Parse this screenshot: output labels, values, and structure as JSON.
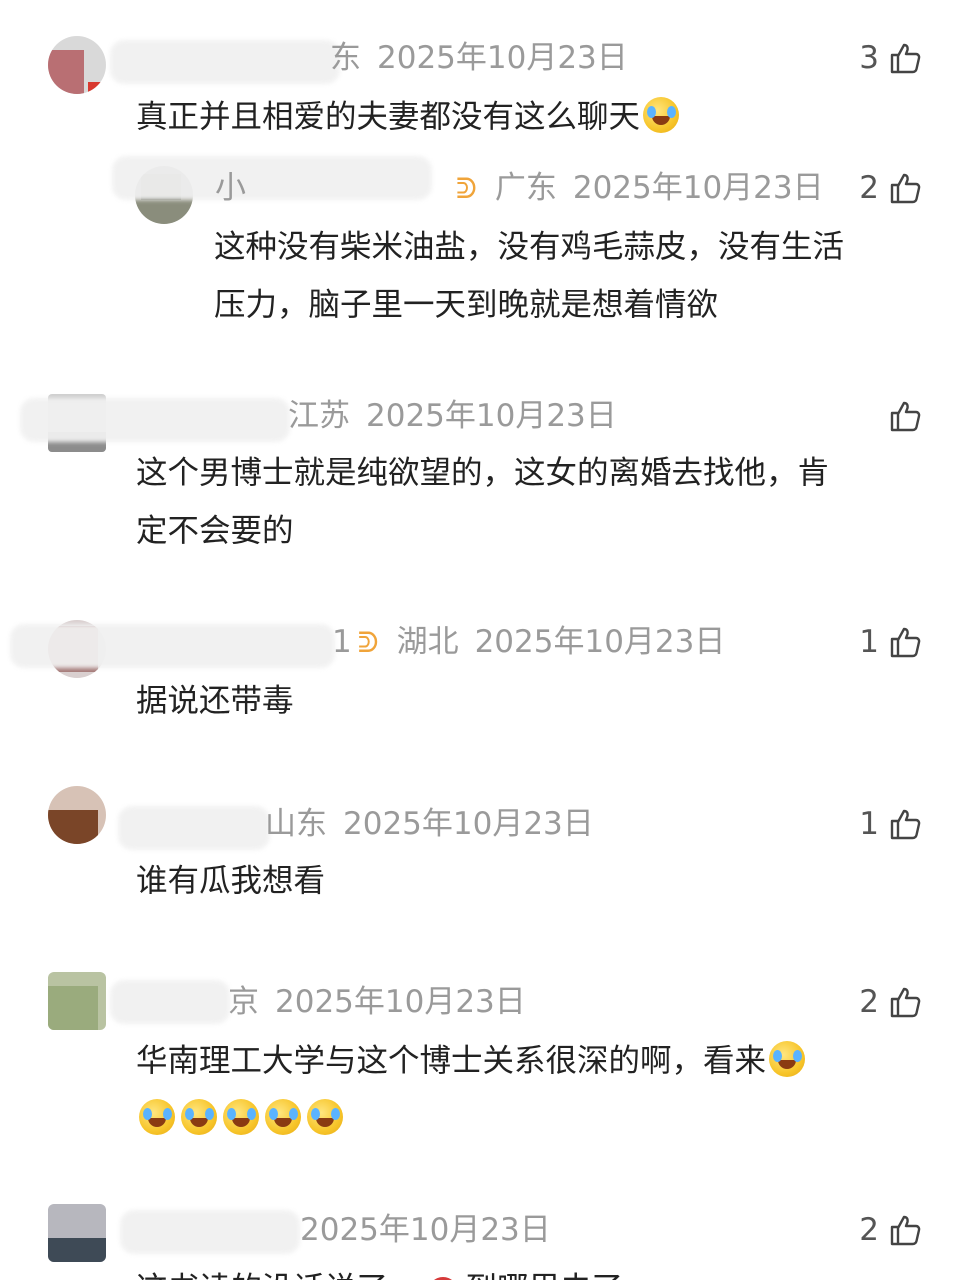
{
  "comments": [
    {
      "region": "东",
      "date": "2025年10月23日",
      "likes": "3",
      "lines": [
        "真正并且相爱的夫妻都没有这么聊天"
      ]
    },
    {
      "name_fragment": "小",
      "region": "广东",
      "date": "2025年10月23日",
      "likes": "2",
      "lines": [
        "这种没有柴米油盐，没有鸡毛蒜皮，没有生活",
        "压力，脑子里一天到晚就是想着情欲"
      ]
    },
    {
      "region": "江苏",
      "date": "2025年10月23日",
      "likes": "",
      "lines": [
        "这个男博士就是纯欲望的，这女的离婚去找他，肯",
        "定不会要的"
      ]
    },
    {
      "name_fragment": "1",
      "region": "湖北",
      "date": "2025年10月23日",
      "likes": "1",
      "lines": [
        "据说还带毒"
      ]
    },
    {
      "region": "山东",
      "date": "2025年10月23日",
      "likes": "1",
      "lines": [
        "谁有瓜我想看"
      ]
    },
    {
      "region": "京",
      "date": "2025年10月23日",
      "likes": "2",
      "lines": [
        "华南理工大学与这个博士关系很深的啊，看来"
      ]
    },
    {
      "region": "",
      "date": "2025年10月23日",
      "likes": "2",
      "lines": [
        "这书读的没话说了，",
        "到哪里去了"
      ]
    }
  ],
  "icons": {
    "like": "thumbs-up-icon",
    "vip": "bow-badge-icon",
    "emoji": "laugh-cry-emoji-icon"
  }
}
